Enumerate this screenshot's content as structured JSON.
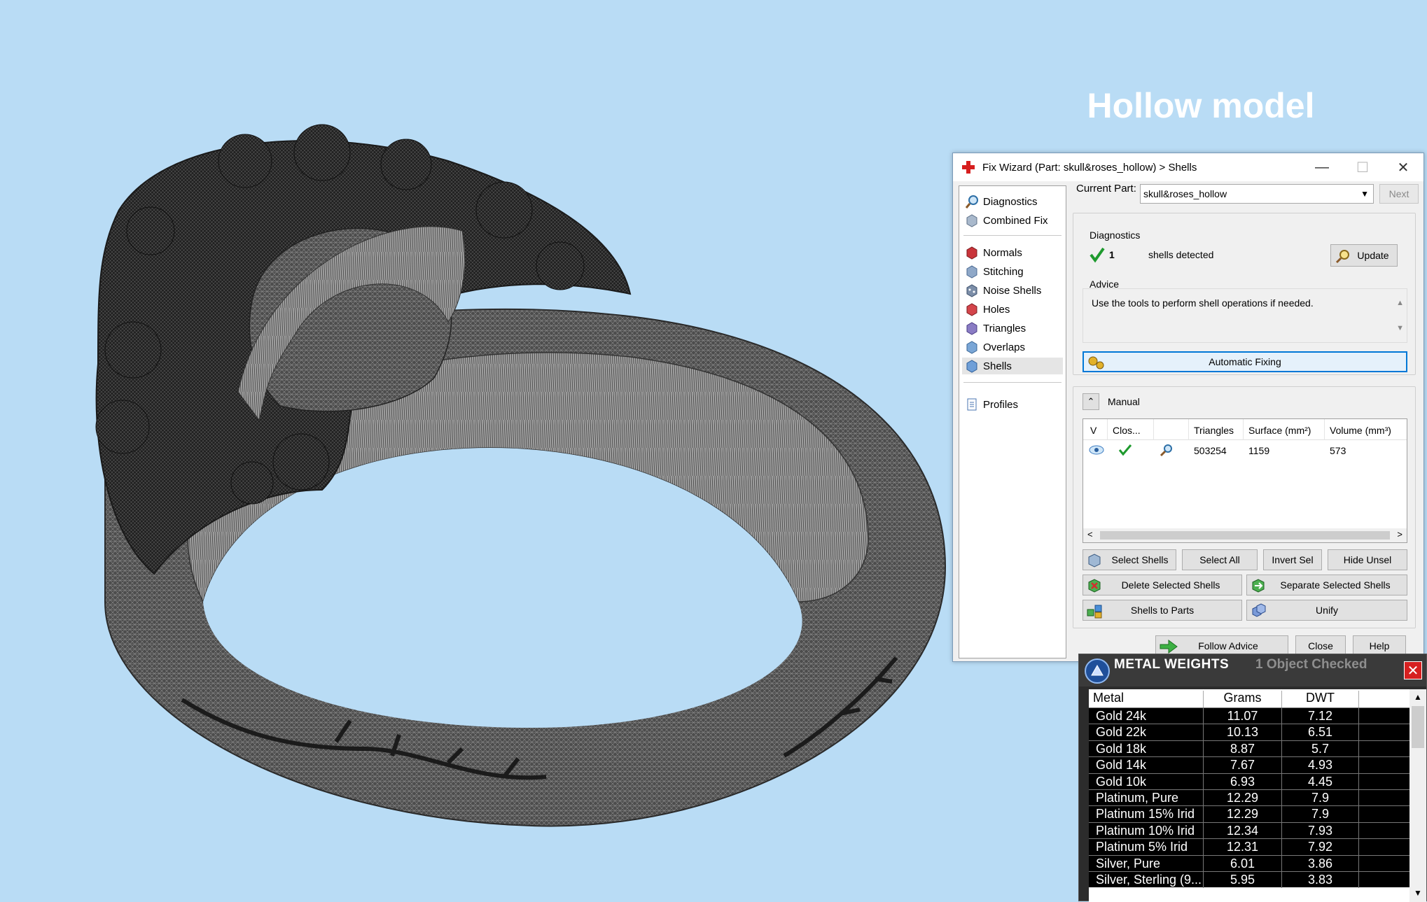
{
  "overlay": {
    "title": "Hollow model"
  },
  "fix_wizard": {
    "title": "Fix Wizard (Part: skull&roses_hollow) > Shells",
    "window_buttons": {
      "minimize": "—",
      "maximize": "☐",
      "close": "✕"
    },
    "nav": {
      "top": [
        "Diagnostics",
        "Combined Fix"
      ],
      "tools": [
        "Normals",
        "Stitching",
        "Noise Shells",
        "Holes",
        "Triangles",
        "Overlaps",
        "Shells"
      ],
      "bottom": [
        "Profiles"
      ],
      "selected": "Shells"
    },
    "current_part_label": "Current Part:",
    "current_part_value": "skull&roses_hollow",
    "next_label": "Next",
    "diagnostics": {
      "title": "Diagnostics",
      "count": "1",
      "text": "shells detected",
      "update_label": "Update"
    },
    "advice": {
      "title": "Advice",
      "text": "Use the tools to perform shell operations if needed."
    },
    "automatic_fixing_label": "Automatic Fixing",
    "manual": {
      "title": "Manual",
      "columns": [
        "V",
        "Clos...",
        "",
        "Triangles",
        "Surface (mm²)",
        "Volume (mm³)"
      ],
      "rows": [
        {
          "triangles": "503254",
          "surface": "1159",
          "volume": "573"
        }
      ]
    },
    "buttons": {
      "select_shells": "Select Shells",
      "select_all": "Select All",
      "invert_sel": "Invert Sel",
      "hide_unsel": "Hide Unsel",
      "delete_selected": "Delete Selected Shells",
      "separate_selected": "Separate Selected Shells",
      "shells_to_parts": "Shells to Parts",
      "unify": "Unify",
      "follow_advice": "Follow Advice",
      "close": "Close",
      "help": "Help"
    }
  },
  "metal_weights": {
    "title": "METAL WEIGHTS",
    "status": "1 Object Checked",
    "close": "✕",
    "columns": [
      "Metal",
      "Grams",
      "DWT"
    ],
    "rows": [
      {
        "metal": "Gold 24k",
        "grams": "11.07",
        "dwt": "7.12"
      },
      {
        "metal": "Gold 22k",
        "grams": "10.13",
        "dwt": "6.51"
      },
      {
        "metal": "Gold 18k",
        "grams": "8.87",
        "dwt": "5.7"
      },
      {
        "metal": "Gold 14k",
        "grams": "7.67",
        "dwt": "4.93"
      },
      {
        "metal": "Gold 10k",
        "grams": "6.93",
        "dwt": "4.45"
      },
      {
        "metal": "Platinum, Pure",
        "grams": "12.29",
        "dwt": "7.9"
      },
      {
        "metal": "Platinum 15% Irid",
        "grams": "12.29",
        "dwt": "7.9"
      },
      {
        "metal": "Platinum 10% Irid",
        "grams": "12.34",
        "dwt": "7.93"
      },
      {
        "metal": "Platinum 5% Irid",
        "grams": "12.31",
        "dwt": "7.92"
      },
      {
        "metal": "Silver, Pure",
        "grams": "6.01",
        "dwt": "3.86"
      },
      {
        "metal": "Silver, Sterling (9...",
        "grams": "5.95",
        "dwt": "3.83"
      }
    ]
  },
  "colors": {
    "background": "#b9dcf5",
    "mesh": "#4a4a4a",
    "accent": "#0078d7",
    "check_green": "#1e9a2e"
  }
}
